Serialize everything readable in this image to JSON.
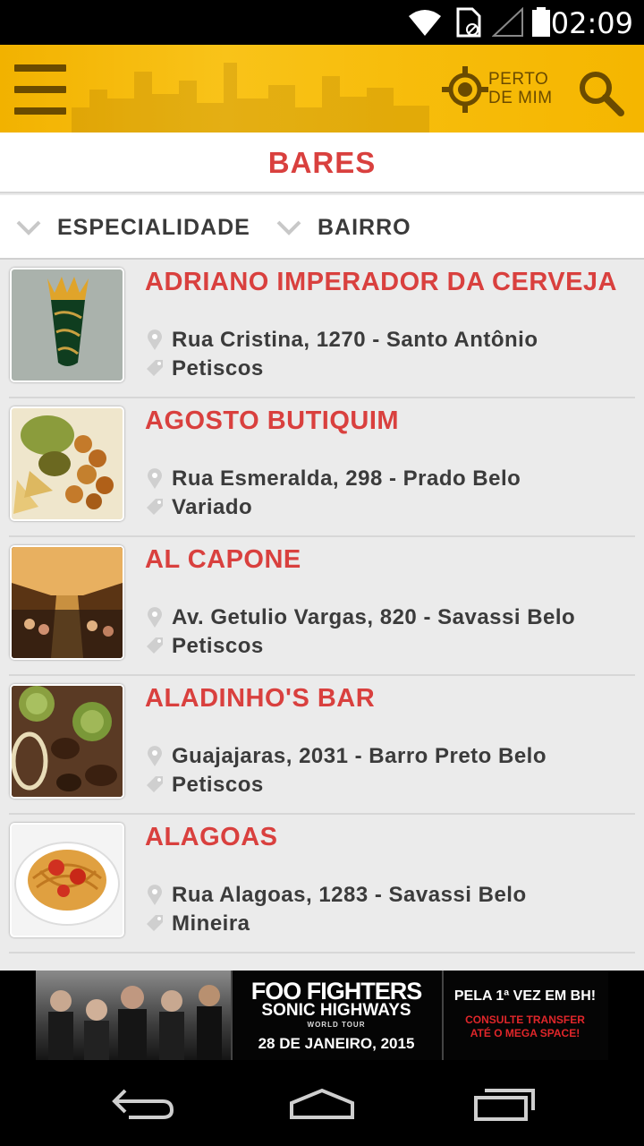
{
  "status_bar": {
    "time": "02:09",
    "icons": [
      "wifi-icon",
      "sim-card-icon",
      "signal-icon",
      "battery-icon"
    ]
  },
  "app_bar": {
    "menu_icon": "hamburger-menu-icon",
    "near_me": {
      "line1": "PERTO",
      "line2": "DE MIM",
      "icon": "location-target-icon"
    },
    "search_icon": "search-icon",
    "background_color": "#f7bd0c",
    "icon_color": "#6b4b00"
  },
  "page": {
    "title": "BARES"
  },
  "filters": [
    {
      "label": "ESPECIALIDADE",
      "icon": "chevron-down-icon"
    },
    {
      "label": "BAIRRO",
      "icon": "chevron-down-icon"
    }
  ],
  "bars": [
    {
      "name": "ADRIANO IMPERADOR DA CERVEJA",
      "address": "Rua Cristina, 1270 - Santo Antônio",
      "category": "Petiscos",
      "thumb": "logo-crown"
    },
    {
      "name": "AGOSTO BUTIQUIM",
      "address": "Rua Esmeralda, 298 - Prado Belo",
      "category": "Variado",
      "thumb": "food-fried"
    },
    {
      "name": "AL CAPONE",
      "address": "Av. Getulio Vargas, 820  - Savassi Belo",
      "category": "Petiscos",
      "thumb": "bar-interior"
    },
    {
      "name": "ALADINHO'S BAR",
      "address": "Guajajaras, 2031 - Barro Preto Belo",
      "category": "Petiscos",
      "thumb": "food-meat"
    },
    {
      "name": "ALAGOAS",
      "address": "Rua Alagoas, 1283 - Savassi Belo",
      "category": "Mineira",
      "thumb": "food-pasta"
    }
  ],
  "ad": {
    "headline": "FOO FIGHTERS",
    "subhead": "SONIC HIGHWAYS",
    "tour": "WORLD TOUR",
    "date": "28 DE JANEIRO, 2015",
    "right_line1": "PELA 1ª VEZ EM BH!",
    "right_line2": "CONSULTE TRANSFER",
    "right_line3": "ATÉ O MEGA SPACE!"
  },
  "nav_bar": {
    "icons": [
      "back-icon",
      "home-icon",
      "recent-apps-icon"
    ]
  },
  "colors": {
    "accent_red": "#d9403e",
    "text_dark": "#3b3b3b",
    "list_bg": "#ebebeb"
  }
}
